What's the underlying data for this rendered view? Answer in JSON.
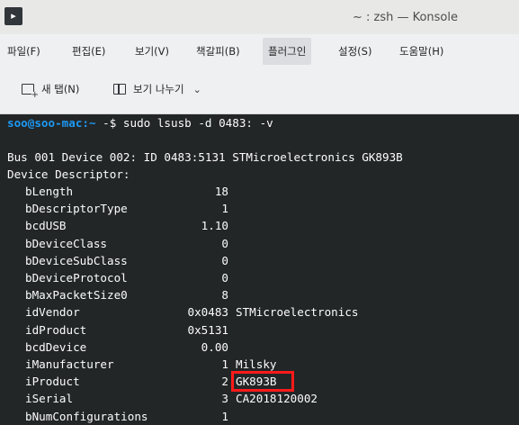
{
  "window": {
    "title": "~ : zsh — Konsole",
    "icon": "terminal-app-icon"
  },
  "menubar": {
    "items": [
      {
        "label": "파일(F)"
      },
      {
        "label": "편집(E)"
      },
      {
        "label": "보기(V)"
      },
      {
        "label": "책갈피(B)"
      },
      {
        "label": "플러그인"
      },
      {
        "label": "설정(S)"
      },
      {
        "label": "도움말(H)"
      }
    ],
    "active_index": 4
  },
  "toolbar": {
    "new_tab_label": "새 탭(N)",
    "split_view_label": "보기 나누기",
    "split_dropdown_icon": "chevron-down-icon"
  },
  "terminal": {
    "prompt": {
      "user_host": "soo@soo-mac",
      "path": ":~",
      "symbol": " -$ ",
      "command": "sudo lsusb -d 0483: -v"
    },
    "bus_line": "Bus 001 Device 002: ID 0483:5131 STMicroelectronics GK893B",
    "section": "Device Descriptor:",
    "fields": [
      {
        "name": "bLength",
        "value": "18",
        "desc": ""
      },
      {
        "name": "bDescriptorType",
        "value": "1",
        "desc": ""
      },
      {
        "name": "bcdUSB",
        "value": "1.10",
        "desc": ""
      },
      {
        "name": "bDeviceClass",
        "value": "0",
        "desc": ""
      },
      {
        "name": "bDeviceSubClass",
        "value": "0",
        "desc": ""
      },
      {
        "name": "bDeviceProtocol",
        "value": "0",
        "desc": ""
      },
      {
        "name": "bMaxPacketSize0",
        "value": "8",
        "desc": ""
      },
      {
        "name": "idVendor",
        "value": "0x0483",
        "desc": "STMicroelectronics"
      },
      {
        "name": "idProduct",
        "value": "0x5131",
        "desc": ""
      },
      {
        "name": "bcdDevice",
        "value": "0.00",
        "desc": ""
      },
      {
        "name": "iManufacturer",
        "value": "1",
        "desc": "Milsky"
      },
      {
        "name": "iProduct",
        "value": "2",
        "desc": "GK893B"
      },
      {
        "name": "iSerial",
        "value": "3",
        "desc": "CA2018120002"
      },
      {
        "name": "bNumConfigurations",
        "value": "1",
        "desc": ""
      }
    ],
    "highlighted_field_index": 11
  },
  "colors": {
    "terminal_bg": "#232627",
    "terminal_fg": "#fcfcfc",
    "prompt_blue": "#1d99f3",
    "highlight_red": "#ff1a1a"
  }
}
